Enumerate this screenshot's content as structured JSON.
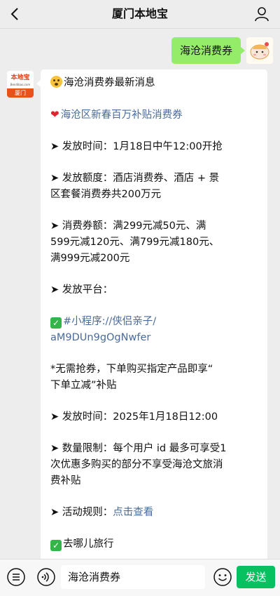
{
  "header": {
    "title": "厦门本地宝"
  },
  "outgoing": {
    "text": "海沧消费券"
  },
  "bot_avatar": {
    "logo": "本地宝",
    "url": "Bendibao.com",
    "city": "厦门"
  },
  "message": {
    "headline": "海沧消费券最新消息",
    "subheadline": "海沧区新春百万补贴消费券",
    "p1": "➤ 发放时间：1月18日中午12:00开抢",
    "p2_l1": "➤ 发放额度：酒店消费券、酒店 + 景",
    "p2_l2": "区套餐消费券共200万元",
    "p3_l1": "➤ 消费券额：满299元减50元、满",
    "p3_l2": "599元减120元、满799元减180元、",
    "p3_l3": "满999元减200元",
    "p4": "➤ 发放平台：",
    "mini_l1": "#小程序://侠侣亲子/",
    "mini_l2": "aM9DUn9gOgNwfer",
    "p5_l1": "*无需抢券，下单购买指定产品即享“",
    "p5_l2": "下单立减”补贴",
    "p6": "➤ 发放时间：2025年1月18日12:00",
    "p7_l1": "➤ 数量限制：每个用户 id 最多可享受1",
    "p7_l2": "次优惠多购买的部分不享受海沧文旅消",
    "p7_l3": "费补贴",
    "p8_prefix": "➤ 活动规则：",
    "p8_link": "点击查看",
    "p9": "去哪儿旅行"
  },
  "input": {
    "value": "海沧消费券"
  },
  "send": {
    "label": "发送"
  },
  "colors": {
    "send": "#07c160",
    "bubble_out": "#95ec69",
    "link": "#4a6b9a"
  }
}
